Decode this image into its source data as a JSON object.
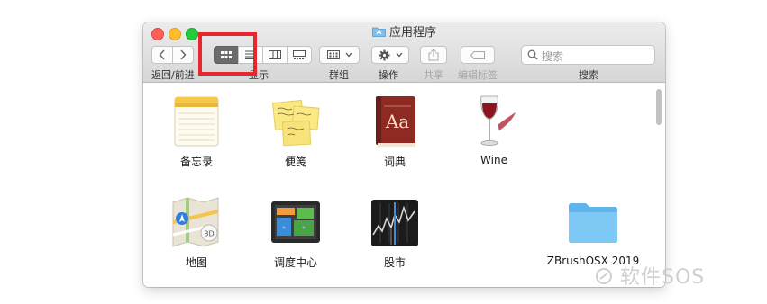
{
  "window": {
    "title": "应用程序"
  },
  "toolbar": {
    "nav_label": "返回/前进",
    "display_label": "显示",
    "group_label": "群组",
    "action_label": "操作",
    "share_label": "共享",
    "tags_label": "编辑标签",
    "search_label": "搜索"
  },
  "search": {
    "placeholder": "搜索"
  },
  "apps": [
    {
      "label": "备忘录",
      "icon": "notes-icon"
    },
    {
      "label": "便笺",
      "icon": "stickies-icon"
    },
    {
      "label": "词典",
      "icon": "dictionary-icon"
    },
    {
      "label": "Wine",
      "icon": "wine-icon"
    },
    {
      "label": "地图",
      "icon": "maps-icon"
    },
    {
      "label": "调度中心",
      "icon": "mission-control-icon"
    },
    {
      "label": "股市",
      "icon": "stocks-icon"
    },
    {
      "label": "ZBrushOSX 2019",
      "icon": "folder-icon"
    }
  ],
  "annotation": {
    "color": "#e8262d"
  },
  "watermark": "软件SOS"
}
